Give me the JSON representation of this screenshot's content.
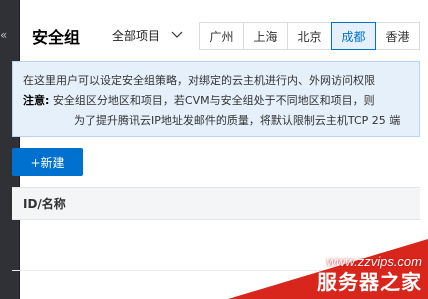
{
  "header": {
    "title": "安全组",
    "project_select": "全部项目",
    "regions": [
      {
        "label": "广州",
        "active": false
      },
      {
        "label": "上海",
        "active": false
      },
      {
        "label": "北京",
        "active": false
      },
      {
        "label": "成都",
        "active": true
      },
      {
        "label": "香港",
        "active": false
      }
    ]
  },
  "notice": {
    "line1": "在这里用户可以设定安全组策略，对绑定的云主机进行内、外网访问权限",
    "note_label": "注意:",
    "line2": "安全组区分地区和项目，若CVM与安全组处于不同地区和项目，则",
    "line3": "为了提升腾讯云IP地址发邮件的质量，将默认限制云主机TCP 25 端"
  },
  "toolbar": {
    "create_label": "+新建"
  },
  "table": {
    "columns": [
      "ID/名称"
    ]
  },
  "watermark": {
    "url": "www.zzvips.com",
    "brand": "服务器之家"
  },
  "colors": {
    "accent": "#0071ce",
    "notice_bg": "#e5f0fb",
    "watermark_red": "#d8261c"
  }
}
